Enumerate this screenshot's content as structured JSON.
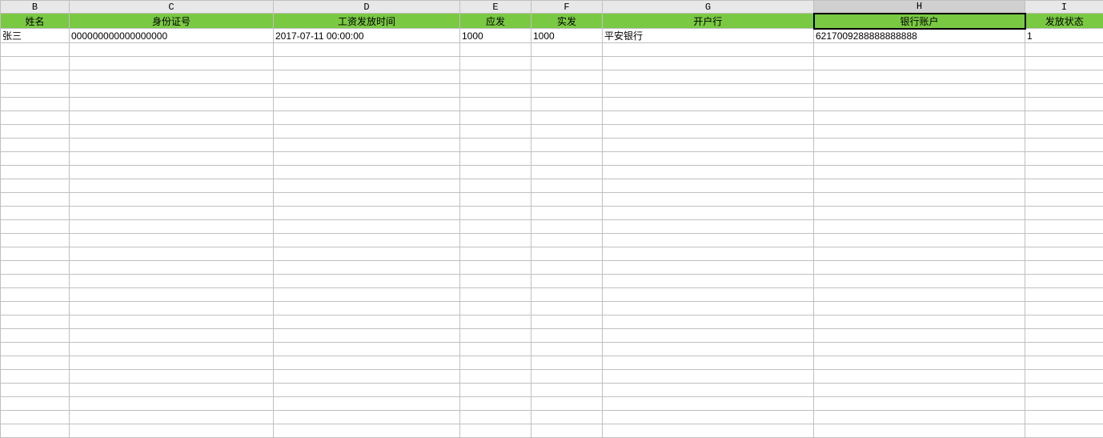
{
  "columns": {
    "letters": [
      "B",
      "C",
      "D",
      "E",
      "F",
      "G",
      "H",
      "I"
    ],
    "headers": [
      "姓名",
      "身份证号",
      "工资发放时间",
      "应发",
      "实发",
      "开户行",
      "银行账户",
      "发放状态"
    ]
  },
  "selected_column_index": 6,
  "rows": [
    {
      "cells": [
        "张三",
        "000000000000000000",
        "2017-07-11 00:00:00",
        "1000",
        "1000",
        "平安银行",
        "6217009288888888888",
        "1"
      ]
    }
  ],
  "empty_row_count": 29
}
